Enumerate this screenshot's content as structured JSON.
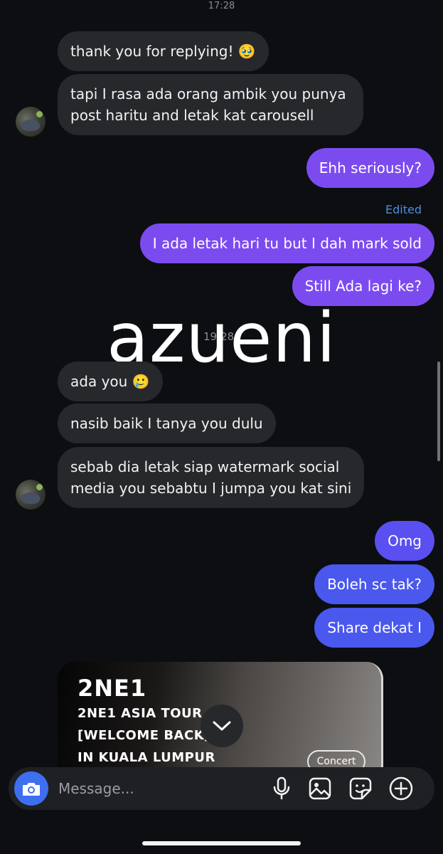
{
  "top_timestamp": "17:28",
  "messages": {
    "m1": "thank you for replying! 🥹",
    "m2_line1": "tapi I rasa ada orang ambik you punya",
    "m2_line2": "post haritu and letak kat carousell",
    "m3": "Ehh seriously?",
    "edited_label": "Edited",
    "m4": "I ada letak hari tu but I dah mark sold",
    "m5": "Still Ada lagi ke?",
    "mid_timestamp": "19:28",
    "m6": "ada you 🥲",
    "m7": "nasib baik I tanya you dulu",
    "m8_line1": "sebab dia letak siap watermark social",
    "m8_line2": "media you sebabtu I jumpa you kat sini",
    "m9": "Omg",
    "m10": "Boleh sc tak?",
    "m11": "Share dekat I"
  },
  "watermark": "azueni",
  "shared_card": {
    "brand": "2NE1",
    "line1": "2NE1 ASIA TOUR",
    "line2": "[WELCOME BACK]",
    "line3": "IN KUALA LUMPUR",
    "tag": "Concert"
  },
  "composer": {
    "placeholder": "Message..."
  },
  "icons": {
    "camera": "camera-icon",
    "scroll_down": "chevron-down-icon",
    "mic": "microphone-icon",
    "gallery": "image-icon",
    "sticker": "sticker-icon",
    "add": "plus-circle-icon"
  },
  "colors": {
    "background": "#0c0e11",
    "incoming_bubble": "#26282c",
    "outgoing_purple": "#7c4bf0",
    "outgoing_indigo": "#5a4ff0",
    "outgoing_blue": "#4a58ee",
    "camera_button": "#3d6ff0",
    "edited_text": "#4a8fe0"
  }
}
